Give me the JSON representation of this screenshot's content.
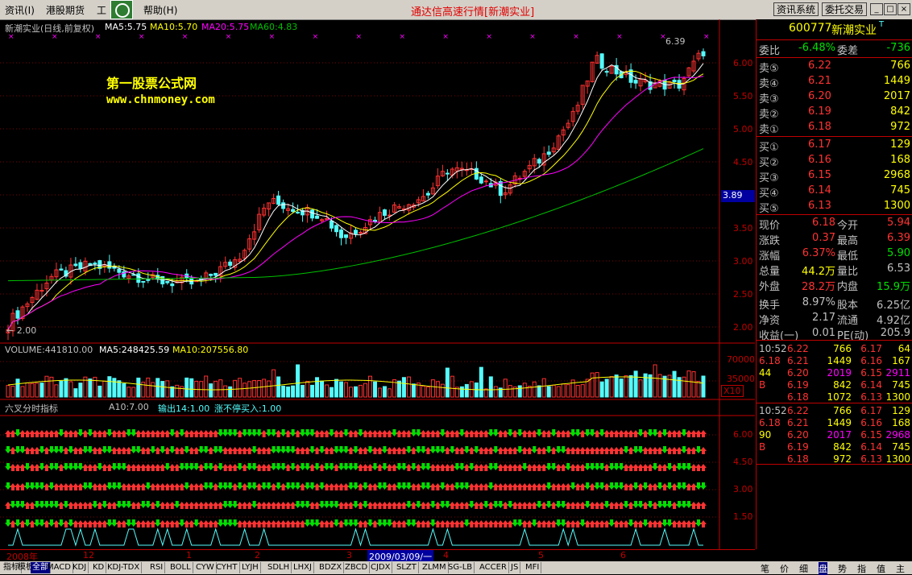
{
  "menu": {
    "items": [
      "资讯(I)",
      "港股期货",
      "工",
      "帮助(H)"
    ]
  },
  "window_title": "通达信高速行情[新潮实业]",
  "sys_buttons": [
    "资讯系统",
    "委托交易"
  ],
  "window_controls": [
    "_",
    "□",
    "×"
  ],
  "price_chart": {
    "header": {
      "name": "新潮实业(日线,前复权)",
      "ma5": "MA5:5.75",
      "ma10": "MA10:5.70",
      "ma20": "MA20:5.75",
      "ma60": "MA60:4.83"
    },
    "high_label": "6.39",
    "low_label": "← 2.00",
    "current_badge": "3.89",
    "watermark_cn": "第一股票公式网",
    "watermark_url": "www.chnmoney.com",
    "y_ticks": [
      "6.00",
      "5.50",
      "5.00",
      "4.50",
      "4.00",
      "3.50",
      "3.00",
      "2.50",
      "2.00"
    ],
    "colors": {
      "up": "#ff3232",
      "down": "#54fcfc",
      "ma5": "#ffffff",
      "ma10": "#ffff00",
      "ma20": "#ff00ff",
      "ma60": "#00c000"
    }
  },
  "volume_chart": {
    "header": {
      "volume": "VOLUME:441810.00",
      "ma5": "MA5:248425.59",
      "ma10": "MA10:207556.80"
    },
    "y_ticks": [
      "70000",
      "35000"
    ],
    "unit": "X10"
  },
  "indicator_chart": {
    "header": {
      "name": "六叉分时指标",
      "a10": "A10:7.00",
      "output": "输出14:1.00",
      "limit": "涨不停买入:1.00"
    },
    "y_ticks": [
      "6.00",
      "4.50",
      "3.00",
      "1.50"
    ]
  },
  "date_axis": {
    "labels": [
      "2008年",
      "12",
      "1",
      "2",
      "3",
      "2009/03/09/一",
      "4",
      "5",
      "6"
    ]
  },
  "bottom_tabs": [
    "指标",
    "模板",
    "全部",
    "MACD",
    "KDJ",
    "KD",
    "KDJ-TDX",
    "RSI",
    "BOLL",
    "CYW",
    "CYHT",
    "LYJH",
    "SDLH",
    "LHXJ",
    "BDZX",
    "ZBCD",
    "CJDX",
    "SLZT",
    "ZLMM",
    "SG-LB",
    "ACCER",
    "JS",
    "MFI"
  ],
  "right_tabs": [
    "笔",
    "价",
    "细",
    "盘",
    "势",
    "指",
    "值",
    "主"
  ],
  "quote": {
    "code": "600777",
    "name": "新潮实业",
    "flag": "T",
    "wei_bi_label": "委比",
    "wei_bi": "-6.48%",
    "wei_cha_label": "委差",
    "wei_cha": "-736",
    "sell": [
      {
        "label": "卖⑤",
        "price": "6.22",
        "vol": "766"
      },
      {
        "label": "卖④",
        "price": "6.21",
        "vol": "1449"
      },
      {
        "label": "卖③",
        "price": "6.20",
        "vol": "2017"
      },
      {
        "label": "卖②",
        "price": "6.19",
        "vol": "842"
      },
      {
        "label": "卖①",
        "price": "6.18",
        "vol": "972"
      }
    ],
    "buy": [
      {
        "label": "买①",
        "price": "6.17",
        "vol": "129"
      },
      {
        "label": "买②",
        "price": "6.16",
        "vol": "168"
      },
      {
        "label": "买③",
        "price": "6.15",
        "vol": "2968"
      },
      {
        "label": "买④",
        "price": "6.14",
        "vol": "745"
      },
      {
        "label": "买⑤",
        "price": "6.13",
        "vol": "1300"
      }
    ],
    "stats": [
      {
        "l1": "现价",
        "v1": "6.18",
        "l2": "今开",
        "v2": "5.94"
      },
      {
        "l1": "涨跌",
        "v1": "0.37",
        "l2": "最高",
        "v2": "6.39"
      },
      {
        "l1": "涨幅",
        "v1": "6.37%",
        "l2": "最低",
        "v2": "5.90"
      },
      {
        "l1": "总量",
        "v1": "44.2万",
        "l2": "量比",
        "v2": "6.53"
      },
      {
        "l1": "外盘",
        "v1": "28.2万",
        "l2": "内盘",
        "v2": "15.9万"
      },
      {
        "l1": "换手",
        "v1": "8.97%",
        "l2": "股本",
        "v2": "6.25亿"
      },
      {
        "l1": "净资",
        "v1": "2.17",
        "l2": "流通",
        "v2": "4.92亿"
      },
      {
        "l1": "收益(一)",
        "v1": "0.01",
        "l2": "PE(动)",
        "v2": "205.9"
      }
    ],
    "ticks1": [
      [
        "10:52",
        "6.22",
        "766",
        "6.17",
        "64"
      ],
      [
        "6.18",
        "6.21",
        "1449",
        "6.16",
        "167"
      ],
      [
        "44",
        "6.20",
        "2019",
        "6.15",
        "2911"
      ],
      [
        "B",
        "6.19",
        "842",
        "6.14",
        "745"
      ],
      [
        "",
        "6.18",
        "1072",
        "6.13",
        "1300"
      ]
    ],
    "ticks2": [
      [
        "10:52",
        "6.22",
        "766",
        "6.17",
        "129"
      ],
      [
        "6.18",
        "6.21",
        "1449",
        "6.16",
        "168"
      ],
      [
        "90",
        "6.20",
        "2017",
        "6.15",
        "2968"
      ],
      [
        "B",
        "6.19",
        "842",
        "6.14",
        "745"
      ],
      [
        "",
        "6.18",
        "972",
        "6.13",
        "1300"
      ]
    ]
  }
}
